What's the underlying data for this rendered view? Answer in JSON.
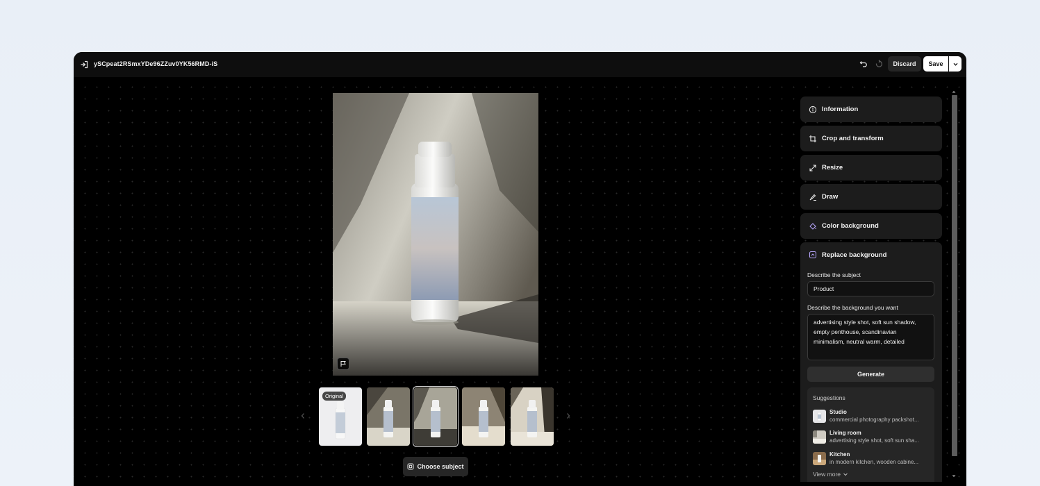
{
  "header": {
    "file_name": "ySCpeat2RSmxYDe96ZZuv0YK56RMD-iS",
    "discard_label": "Discard",
    "save_label": "Save"
  },
  "gallery": {
    "thumbnails": [
      {
        "badge": "Original",
        "selected": false
      },
      {
        "badge": "",
        "selected": false
      },
      {
        "badge": "",
        "selected": true
      },
      {
        "badge": "",
        "selected": false
      },
      {
        "badge": "",
        "selected": false
      }
    ],
    "choose_subject_label": "Choose subject"
  },
  "tools": {
    "information": "Information",
    "crop": "Crop and transform",
    "resize": "Resize",
    "draw": "Draw",
    "color_background": "Color background",
    "replace_background": "Replace background"
  },
  "replace_panel": {
    "subject_label": "Describe the subject",
    "subject_value": "Product",
    "background_label": "Describe the background you want",
    "background_value": "advertising style shot, soft sun shadow, empty penthouse, scandinavian minimalism, neutral warm, detailed",
    "generate_label": "Generate",
    "suggestions_title": "Suggestions",
    "suggestions": [
      {
        "name": "Studio",
        "desc": "commercial photography packshot..."
      },
      {
        "name": "Living room",
        "desc": "advertising style shot, soft sun sha..."
      },
      {
        "name": "Kitchen",
        "desc": "in modern kitchen, wooden cabine..."
      }
    ],
    "view_more_label": "View more"
  },
  "colors": {
    "accent": "#b9a8ff",
    "window_bg": "#000000",
    "panel_bg": "#1c1c1c"
  }
}
